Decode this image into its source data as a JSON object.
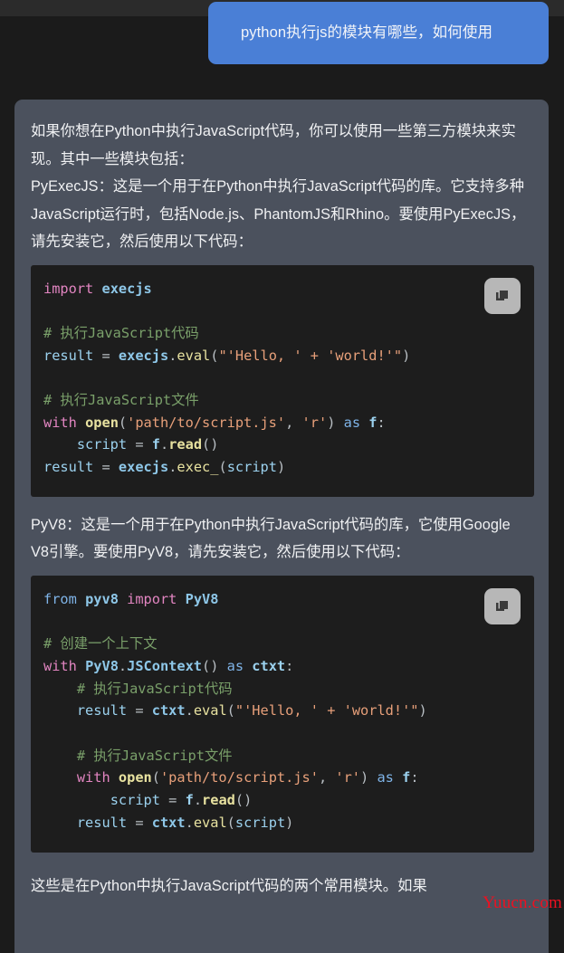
{
  "window": {
    "background_color": "#1b1b1b",
    "top_bar_color": "#2b2b2b"
  },
  "conversation": {
    "user_message": {
      "role": "user",
      "text": "python执行js的模块有哪些，如何使用",
      "bubble_color": "#4a7fd6",
      "text_color": "#f2f4f8"
    },
    "assistant_message": {
      "role": "assistant",
      "bubble_color": "#4b515d",
      "text_color": "#f0f1f3",
      "paragraph_1": "如果你想在Python中执行JavaScript代码，你可以使用一些第三方模块来实现。其中一些模块包括：",
      "paragraph_2": "PyExecJS：这是一个用于在Python中执行JavaScript代码的库。它支持多种JavaScript运行时，包括Node.js、PhantomJS和Rhino。要使用PyExecJS，请先安装它，然后使用以下代码：",
      "paragraph_3": "PyV8：这是一个用于在Python中执行JavaScript代码的库，它使用Google V8引擎。要使用PyV8，请先安装它，然后使用以下代码：",
      "paragraph_4": "这些是在Python中执行JavaScript代码的两个常用模块。如果"
    }
  },
  "code_blocks": [
    {
      "id": "code-block-execjs",
      "language": "python",
      "background_color": "#1d1d1d",
      "copy_button_label": "copy-icon",
      "lines": [
        "import execjs",
        "",
        "# 执行JavaScript代码",
        "result = execjs.eval(\"'Hello, ' + 'world!'\")",
        "",
        "# 执行JavaScript文件",
        "with open('path/to/script.js', 'r') as f:",
        "    script = f.read()",
        "result = execjs.exec_(script)"
      ]
    },
    {
      "id": "code-block-pyv8",
      "language": "python",
      "background_color": "#1d1d1d",
      "copy_button_label": "copy-icon",
      "lines": [
        "from pyv8 import PyV8",
        "",
        "# 创建一个上下文",
        "with PyV8.JSContext() as ctxt:",
        "    # 执行JavaScript代码",
        "    result = ctxt.eval(\"'Hello, ' + 'world!'\")",
        "",
        "    # 执行JavaScript文件",
        "    with open('path/to/script.js', 'r') as f:",
        "        script = f.read()",
        "    result = ctxt.eval(script)"
      ]
    }
  ],
  "watermark": {
    "text": "Yuucn.com",
    "color": "#ee1020"
  },
  "syntax_colors": {
    "keyword": "#e285c1",
    "identifier": "#8ec7e8",
    "function": "#e8e2a0",
    "string": "#e8a07a",
    "comment": "#7aa06a",
    "operator": "#b9bfc4",
    "as_keyword": "#7fb4e8"
  }
}
